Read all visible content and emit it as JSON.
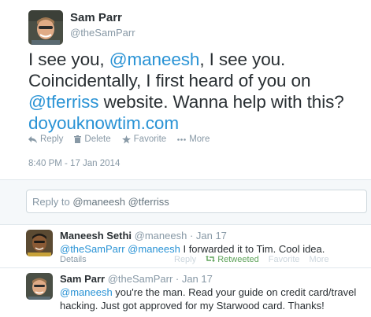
{
  "main_tweet": {
    "name": "Sam Parr",
    "handle": "@theSamParr",
    "text": {
      "l1_pre": "I see you, ",
      "l1_mention": "@maneesh",
      "l1_post": ", I see you.",
      "l2": "Coincidentally, I first heard of you on",
      "l3_mention": "@tferriss",
      "l3_post": " website. Wanna help with this?",
      "l4_link": "doyouknowtim.com"
    },
    "actions": [
      "Reply",
      "Delete",
      "Favorite",
      "More"
    ],
    "timestamp": "8:40 PM - 17 Jan 2014"
  },
  "reply_box": {
    "prefix": "Reply to ",
    "mentions": "@maneesh @tferriss"
  },
  "replies": [
    {
      "name": "Maneesh Sethi",
      "meta": "@maneesh · Jan 17",
      "text_mentions": "@theSamParr @maneesh",
      "text_body": " I forwarded it to Tim. Cool idea.",
      "details": "Details",
      "actions": [
        "Reply",
        "Retweeted",
        "Favorite",
        "More"
      ]
    },
    {
      "name": "Sam Parr",
      "meta": "@theSamParr · Jan 17",
      "text_mentions": "@maneesh",
      "text_body": " you're the man. Read your guide on credit card/travel hacking. Just got approved for my Starwood card. Thanks!"
    }
  ],
  "colors": {
    "link": "#2a93d5",
    "muted": "#8899a6",
    "retweeted": "#5ea35a",
    "bg_conversation": "#f5f8fa"
  }
}
